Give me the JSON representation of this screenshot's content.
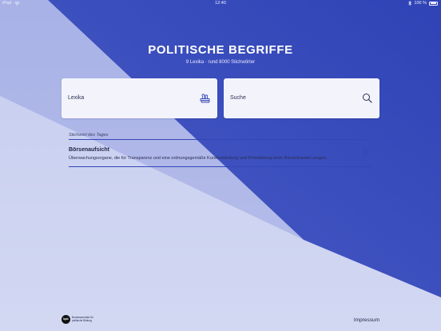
{
  "status_bar": {
    "device": "iPad",
    "time": "12:40",
    "battery": "100 %",
    "wifi_icon": "wifi-icon",
    "bluetooth_icon": "bluetooth-icon"
  },
  "header": {
    "title": "POLITISCHE BEGRIFFE",
    "subtitle": "9 Lexika · rund 8000 Stichwörter"
  },
  "cards": {
    "lexika": {
      "label": "Lexika",
      "icon": "books-icon"
    },
    "suche": {
      "label": "Suche",
      "icon": "search-icon"
    }
  },
  "word_of_day": {
    "section_label": "Stichwort des Tages",
    "title": "Börsenaufsicht",
    "description": "Überwachungsorgane, die für Transparenz und eine ordnungsgemäße Kursfeststellung und Preisbildung beim Börsenhandel sorgen...",
    "icon": "chevron-right-icon"
  },
  "footer": {
    "logo_mark": "bpb",
    "logo_text": "Bundeszentrale für politische Bildung",
    "impressum": "Impressum"
  },
  "colors": {
    "background_blue": "#3a4fbf",
    "background_light": "#c9cfee",
    "card": "#f3f4fb",
    "accent": "#3447b8"
  }
}
